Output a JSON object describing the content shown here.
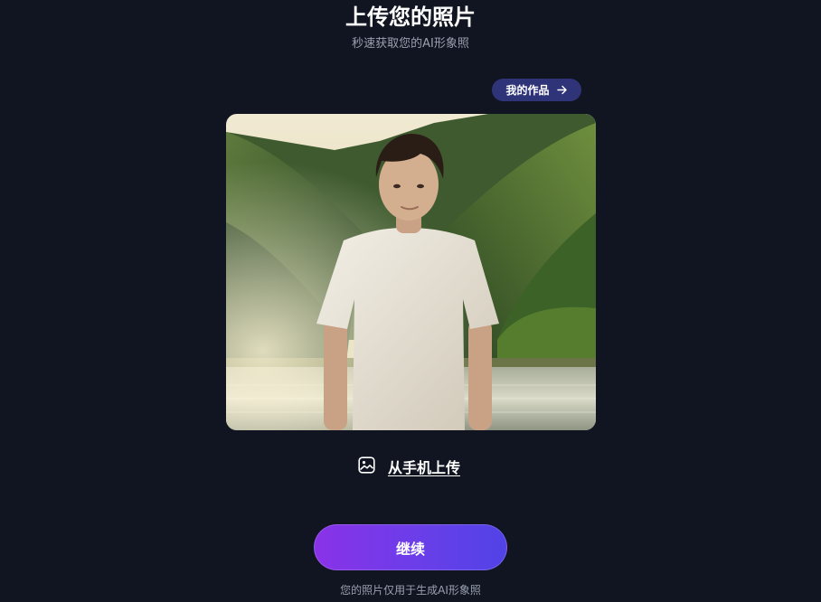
{
  "header": {
    "title": "上传您的照片",
    "subtitle": "秒速获取您的AI形象照"
  },
  "my_works": {
    "label": "我的作品",
    "icon": "arrow-right-icon"
  },
  "preview": {
    "icon": "photo-preview"
  },
  "upload": {
    "label": "从手机上传",
    "icon": "image-icon"
  },
  "continue": {
    "label": "继续"
  },
  "footer": {
    "note": "您的照片仅用于生成AI形象照"
  },
  "colors": {
    "background": "#111521",
    "badge": "#2f3479",
    "button_start": "#8a32e8",
    "button_end": "#5143e6",
    "muted_text": "#9aa0ae"
  }
}
